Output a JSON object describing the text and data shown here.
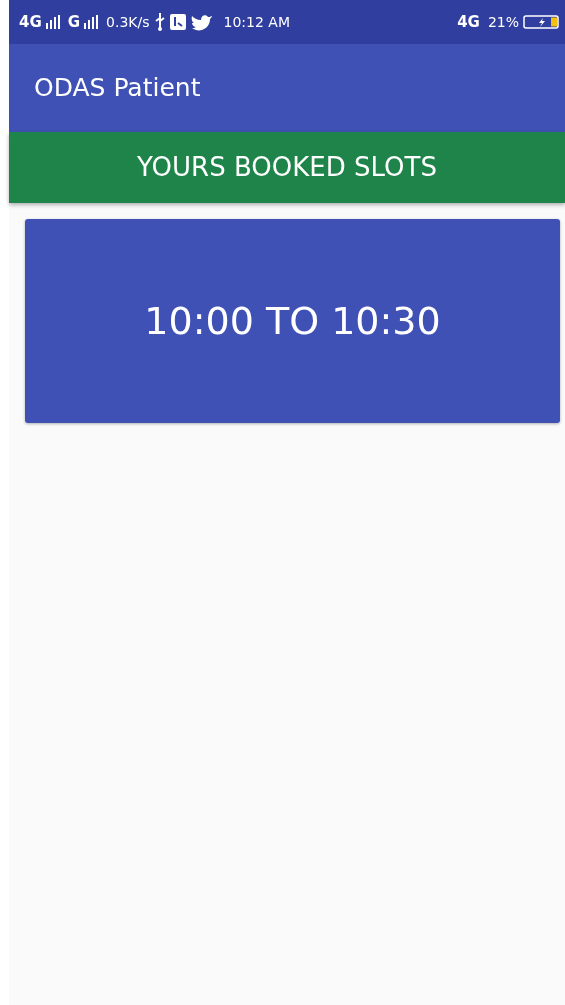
{
  "status_bar": {
    "network_1": "4G",
    "network_2": "G",
    "speed": "0.3K/s",
    "time": "10:12 AM",
    "network_3": "4G",
    "battery": "21%"
  },
  "app_bar": {
    "title": "ODAS Patient"
  },
  "section_header": "YOURS BOOKED SLOTS",
  "slots": [
    {
      "time": "10:00 TO 10:30"
    }
  ]
}
